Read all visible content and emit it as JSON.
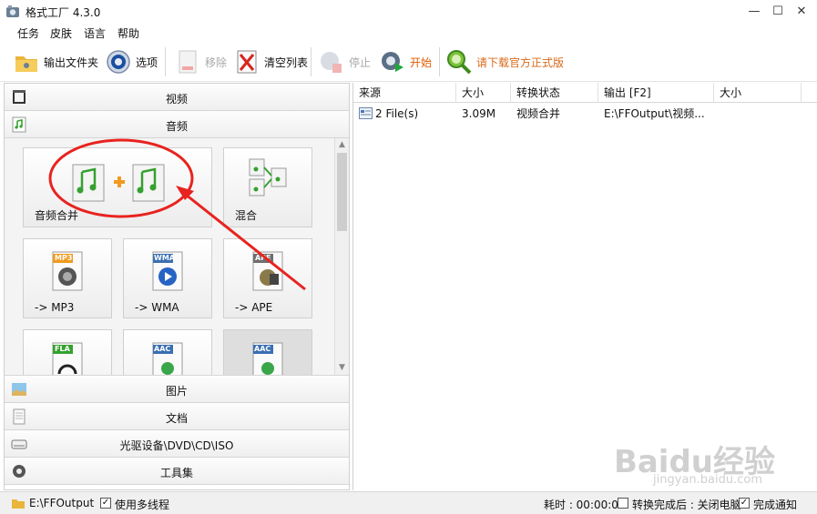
{
  "window": {
    "title": "格式工厂 4.3.0",
    "controls": {
      "minimize": "—",
      "maximize": "☐",
      "close": "✕"
    }
  },
  "menu": [
    "任务",
    "皮肤",
    "语言",
    "帮助"
  ],
  "toolbar": {
    "output_folder": "输出文件夹",
    "options": "选项",
    "remove": "移除",
    "clear_list": "清空列表",
    "stop": "停止",
    "start": "开始",
    "download": "请下载官方正式版"
  },
  "categories": {
    "video": "视频",
    "audio": "音频",
    "picture": "图片",
    "document": "文档",
    "disc": "光驱设备\\DVD\\CD\\ISO",
    "tools": "工具集"
  },
  "audio_tiles": [
    {
      "label": "音频合并",
      "badge": ""
    },
    {
      "label": "混合",
      "badge": ""
    },
    {
      "label": "-> MP3",
      "badge": "MP3"
    },
    {
      "label": "-> WMA",
      "badge": "WMA"
    },
    {
      "label": "-> APE",
      "badge": "APE"
    },
    {
      "label": "",
      "badge": "FLA"
    },
    {
      "label": "",
      "badge": "AAC"
    },
    {
      "label": "",
      "badge": "AAC"
    }
  ],
  "task_table": {
    "headers": [
      "来源",
      "大小",
      "转换状态",
      "输出 [F2]",
      "大小"
    ],
    "rows": [
      {
        "source": "2 File(s)",
        "size": "3.09M",
        "status": "视频合并",
        "output": "E:\\FFOutput\\视频...",
        "out_size": ""
      }
    ]
  },
  "status_bar": {
    "output_path": "E:\\FFOutput",
    "multithread": "使用多线程",
    "multithread_checked": true,
    "elapsed": "耗时 : 00:00:00",
    "after_done": "转换完成后 : 关闭电脑",
    "after_done_checked": false,
    "notify": "完成通知",
    "notify_checked": true
  },
  "watermark": {
    "brand": "Baidu经验",
    "url": "jingyan.baidu.com"
  },
  "colors": {
    "accent_red": "#e8231f",
    "start_orange": "#e05a00",
    "download_orange": "#d86a1a"
  }
}
